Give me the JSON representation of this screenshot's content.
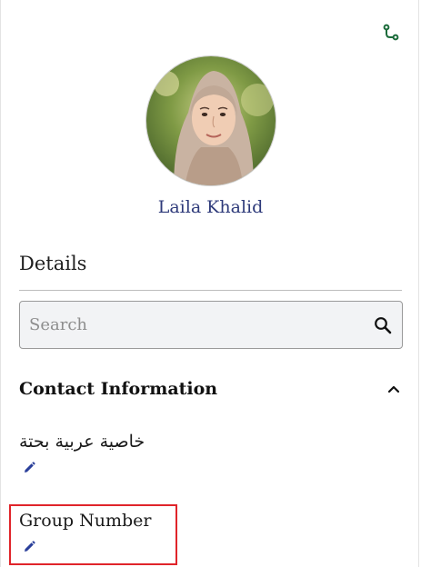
{
  "header": {
    "branch_icon": "branch-icon"
  },
  "contact": {
    "name": "Laila Khalid",
    "avatar_icon": "avatar-photo"
  },
  "details": {
    "title": "Details",
    "search": {
      "placeholder": "Search",
      "value": "",
      "icon": "search-icon"
    },
    "groups": [
      {
        "label": "Contact Information",
        "expanded": true,
        "fields": [
          {
            "label": "خاصية عربية بحتة",
            "edit_icon": "pencil-icon"
          },
          {
            "label": "Group Number",
            "edit_icon": "pencil-icon"
          }
        ]
      }
    ]
  },
  "colors": {
    "name_link": "#2e3a7a",
    "branch_icon": "#1b6b3a",
    "edit_icon": "#2a3f9a",
    "highlight": "#e0242a"
  }
}
